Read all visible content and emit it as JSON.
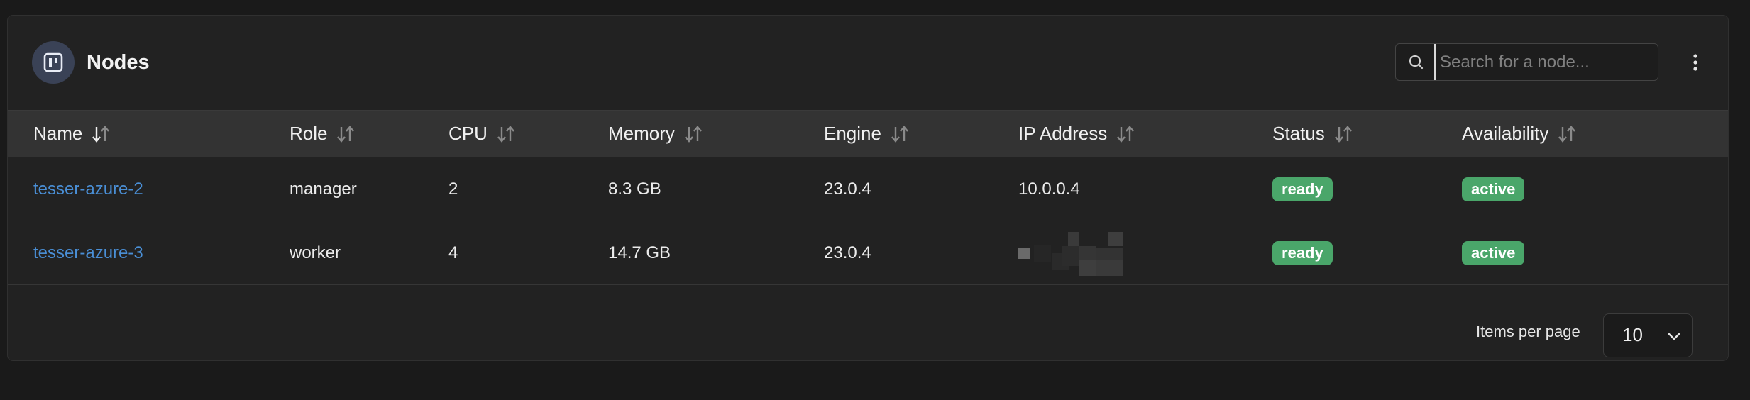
{
  "header": {
    "title": "Nodes",
    "search_placeholder": "Search for a node...",
    "search_value": ""
  },
  "columns": [
    "Name",
    "Role",
    "CPU",
    "Memory",
    "Engine",
    "IP Address",
    "Status",
    "Availability"
  ],
  "sort": {
    "column": "Name",
    "direction": "desc"
  },
  "rows": [
    {
      "name": "tesser-azure-2",
      "role": "manager",
      "cpu": "2",
      "memory": "8.3 GB",
      "engine": "23.0.4",
      "ip": "10.0.0.4",
      "status": "ready",
      "availability": "active"
    },
    {
      "name": "tesser-azure-3",
      "role": "worker",
      "cpu": "4",
      "memory": "14.7 GB",
      "engine": "23.0.4",
      "ip": "",
      "ip_redacted": true,
      "status": "ready",
      "availability": "active"
    }
  ],
  "pagination": {
    "label": "Items per page",
    "value": "10"
  },
  "colors": {
    "page_bg": "#1a1a1a",
    "panel_bg": "#222222",
    "header_row_bg": "#333333",
    "link": "#4a8fd6",
    "badge_green": "#4aa66a",
    "icon_circle": "#3a4256"
  },
  "icons": {
    "title": "nodes-board-icon",
    "search": "search-icon",
    "menu": "kebab-menu-icon",
    "sort": "sort-arrows-icon",
    "select": "chevron-down-icon"
  }
}
